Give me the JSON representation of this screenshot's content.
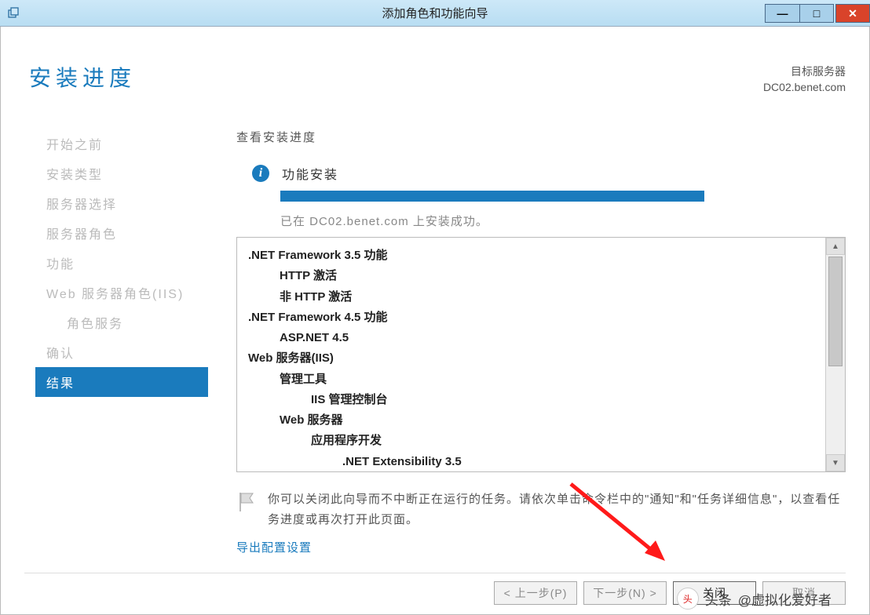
{
  "window": {
    "title": "添加角色和功能向导"
  },
  "page": {
    "title": "安装进度"
  },
  "target": {
    "label": "目标服务器",
    "server": "DC02.benet.com"
  },
  "sidebar": {
    "items": [
      {
        "label": "开始之前",
        "active": false,
        "indent": false
      },
      {
        "label": "安装类型",
        "active": false,
        "indent": false
      },
      {
        "label": "服务器选择",
        "active": false,
        "indent": false
      },
      {
        "label": "服务器角色",
        "active": false,
        "indent": false
      },
      {
        "label": "功能",
        "active": false,
        "indent": false
      },
      {
        "label": "Web 服务器角色(IIS)",
        "active": false,
        "indent": false
      },
      {
        "label": "角色服务",
        "active": false,
        "indent": true
      },
      {
        "label": "确认",
        "active": false,
        "indent": false
      },
      {
        "label": "结果",
        "active": true,
        "indent": false
      }
    ]
  },
  "content": {
    "view_heading": "查看安装进度",
    "status_label": "功能安装",
    "progress_percent": 100,
    "progress_message": "已在 DC02.benet.com 上安装成功。",
    "features": [
      {
        "text": ".NET Framework 3.5 功能",
        "indent": 0
      },
      {
        "text": "HTTP 激活",
        "indent": 1
      },
      {
        "text": "非 HTTP 激活",
        "indent": 1
      },
      {
        "text": ".NET Framework 4.5 功能",
        "indent": 0
      },
      {
        "text": "ASP.NET 4.5",
        "indent": 1
      },
      {
        "text": "Web 服务器(IIS)",
        "indent": 0
      },
      {
        "text": "管理工具",
        "indent": 1
      },
      {
        "text": "IIS 管理控制台",
        "indent": 2
      },
      {
        "text": "Web 服务器",
        "indent": 1
      },
      {
        "text": "应用程序开发",
        "indent": 2
      },
      {
        "text": ".NET Extensibility 3.5",
        "indent": 3
      }
    ],
    "note": "你可以关闭此向导而不中断正在运行的任务。请依次单击命令栏中的\"通知\"和\"任务详细信息\"，以查看任务进度或再次打开此页面。",
    "export_link": "导出配置设置"
  },
  "footer": {
    "prev": "< 上一步(P)",
    "next": "下一步(N) >",
    "close": "关闭",
    "cancel": "取消"
  },
  "watermark": {
    "prefix": "头条",
    "handle": "@虚拟化爱好者"
  }
}
